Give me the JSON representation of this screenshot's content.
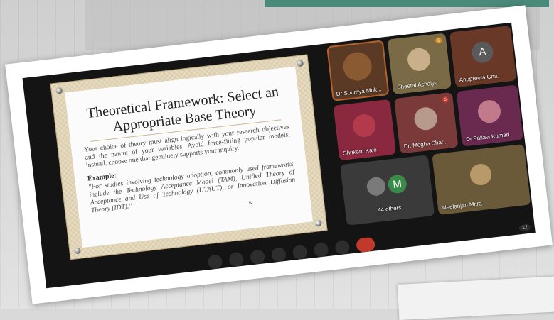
{
  "slide": {
    "title": "Theoretical Framework: Select an Appropriate Base Theory",
    "body": "Your choice of theory must align logically with your research objectives and the nature of your variables. Avoid force-fitting popular models; instead, choose one that genuinely supports your inquiry.",
    "example_label": "Example:",
    "example_text": "\"For studies involving technology adoption, commonly used frameworks include the Technology Acceptance Model (TAM), Unified Theory of Acceptance and Use of Technology (UTAUT), or Innovation Diffusion Theory (IDT).\""
  },
  "participants": [
    {
      "name": "Dr Soumya Muk...",
      "initial": "",
      "color": "#5a3a24",
      "avatar": "#8a5a32",
      "badge": "",
      "selected": true
    },
    {
      "name": "Sheetal Achalye",
      "initial": "",
      "color": "#7a6a45",
      "avatar": "#c9b08a",
      "badge": "6",
      "badge_color": "orange"
    },
    {
      "name": "Anupreeta Cha...",
      "initial": "A",
      "color": "#6a3826",
      "avatar": "#5a5a5a",
      "badge": ""
    },
    {
      "name": "Shrikant Kale",
      "initial": "",
      "color": "#8a2840",
      "avatar": "#b23a4a",
      "badge": ""
    },
    {
      "name": "Dr. Megha Shar...",
      "initial": "",
      "color": "#7a3a3a",
      "avatar": "#b89a8a",
      "badge": "5",
      "badge_color": "red"
    },
    {
      "name": "Dr.Pallavi Kumari",
      "initial": "",
      "color": "#6a2a50",
      "avatar": "#c07a8a",
      "badge": ""
    },
    {
      "name": "44 others",
      "initial": "M",
      "color": "#3a3a3a",
      "avatar": "#3a8a4a",
      "badge": ""
    },
    {
      "name": "Neelanjan Mitra",
      "initial": "",
      "color": "#6a5a3a",
      "avatar": "#b89a6a",
      "badge": ""
    }
  ],
  "page_indicator": "12"
}
